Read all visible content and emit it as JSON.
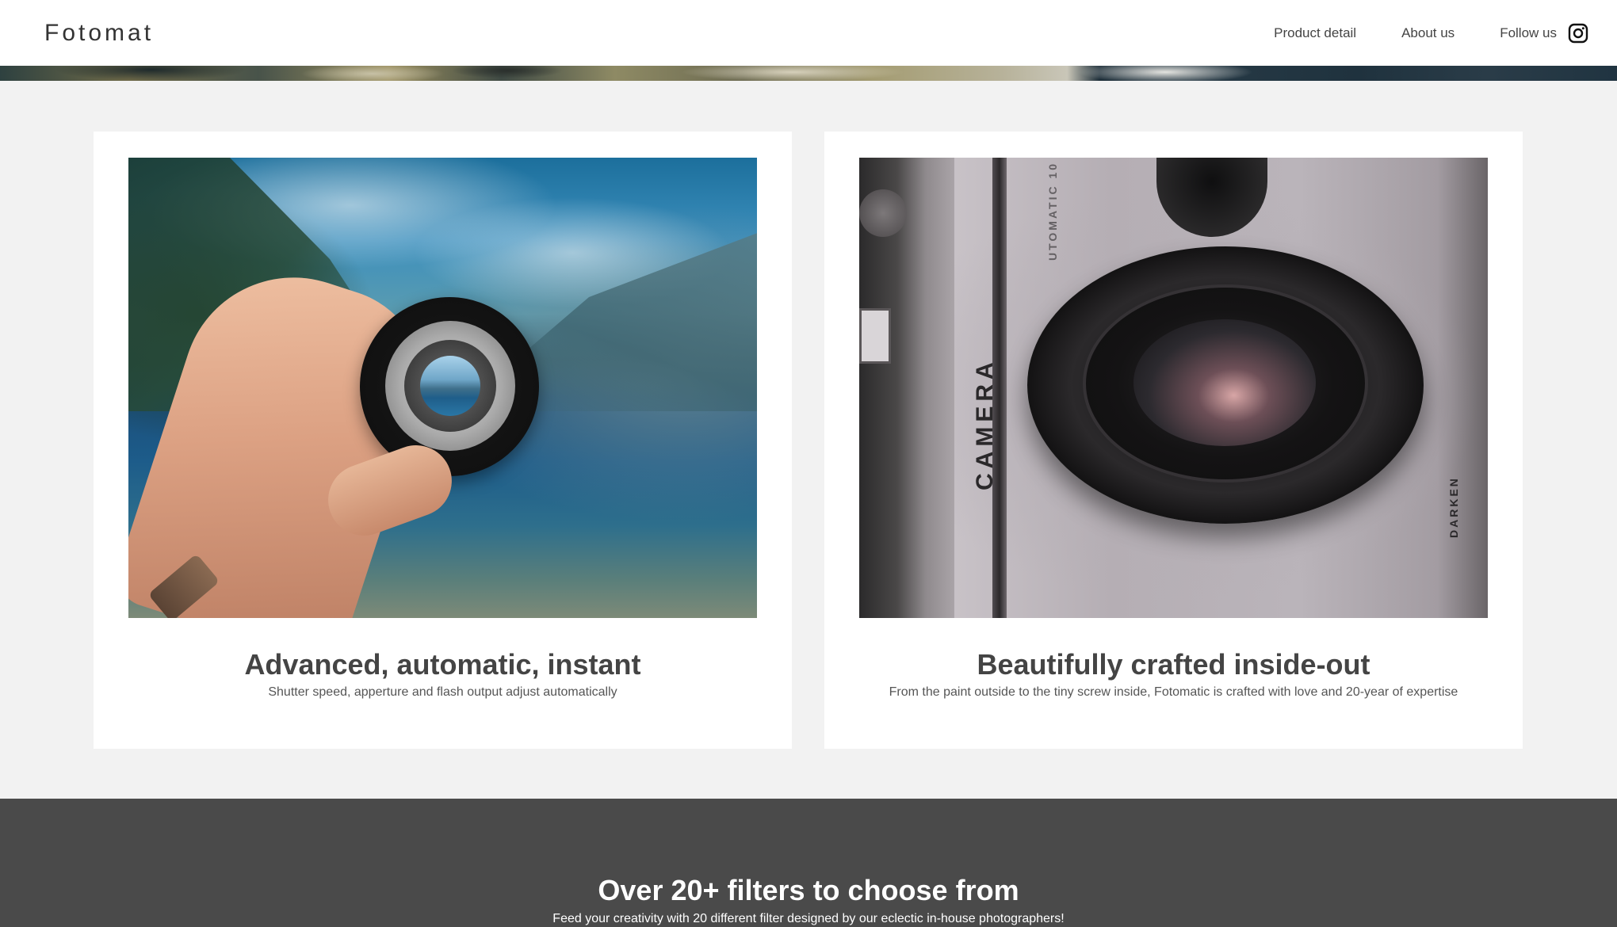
{
  "header": {
    "logo": "Fotomat",
    "nav": {
      "product_detail": "Product detail",
      "about_us": "About us",
      "follow_us": "Follow us"
    },
    "social_icon": "instagram-icon"
  },
  "features": [
    {
      "title": "Advanced, automatic, instant",
      "subtitle": "Shutter speed, apperture and flash output adjust automatically"
    },
    {
      "title": "Beautifully crafted inside-out",
      "subtitle": "From the paint outside to the tiny screw inside, Fotomatic is crafted with love and 20-year of expertise",
      "image_text": {
        "brand": "CAMERA",
        "model": "UTOMATIC 10",
        "control": "DARKEN"
      }
    }
  ],
  "filters": {
    "title": "Over 20+ filters to choose from",
    "subtitle": "Feed your creativity with 20 different filter designed by our eclectic in-house photographers!"
  },
  "colors": {
    "header_bg": "#ffffff",
    "page_bg": "#f2f2f2",
    "card_bg": "#ffffff",
    "dark_section_bg": "#4a4a4a",
    "heading_text": "#444444"
  }
}
